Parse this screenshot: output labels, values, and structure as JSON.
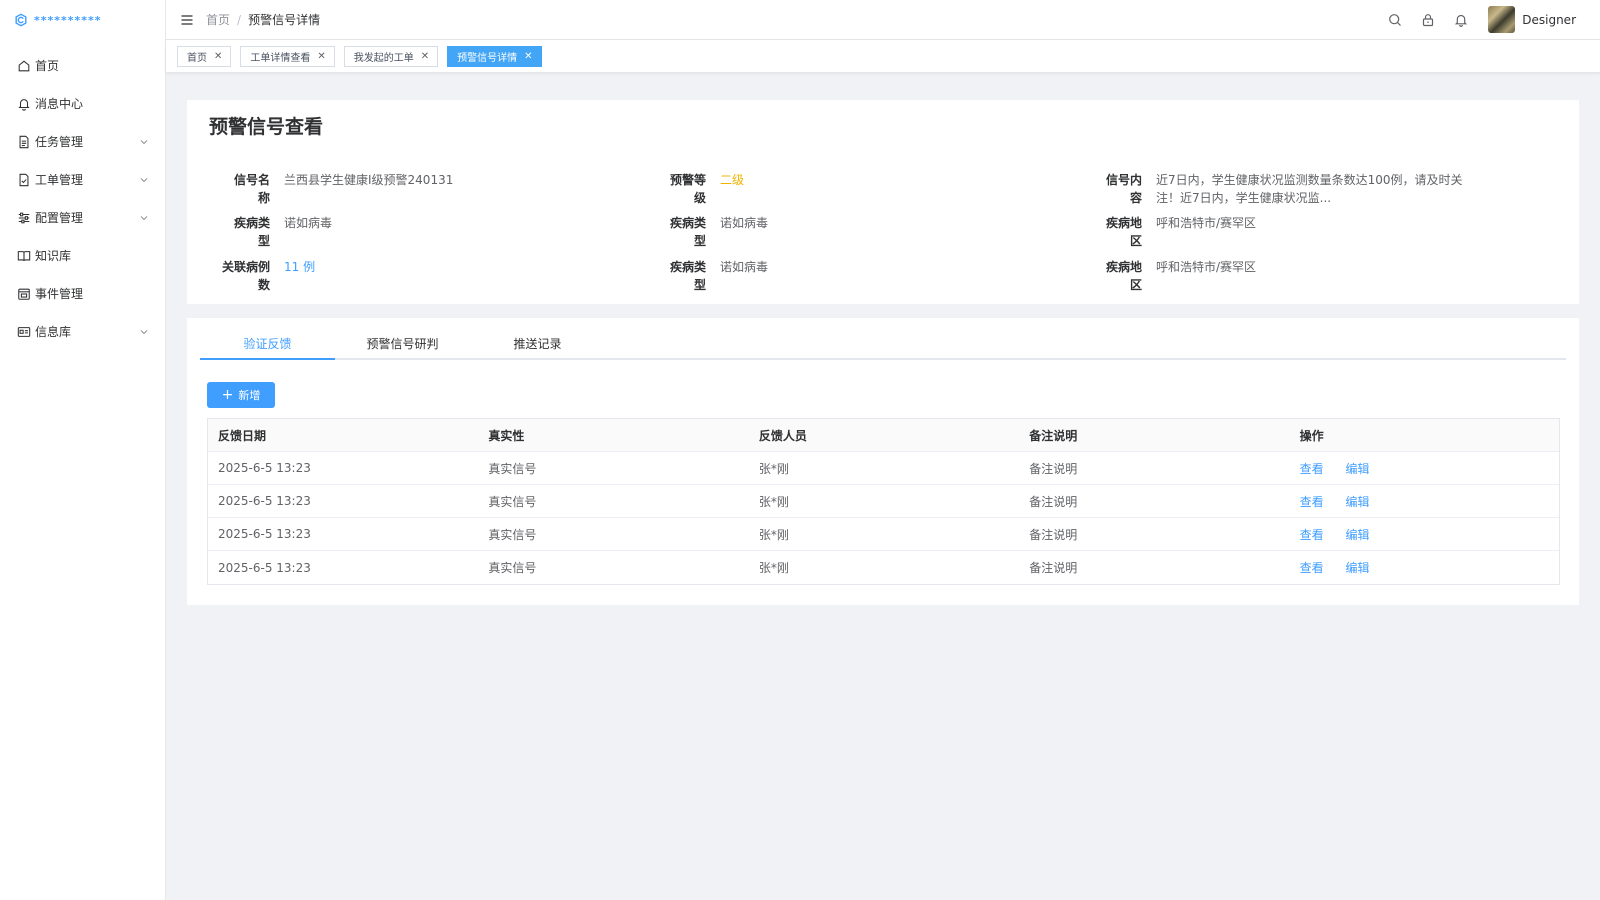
{
  "app": {
    "logo_text": "**********"
  },
  "sidebar": {
    "items": [
      {
        "label": "首页",
        "icon": "home-icon",
        "has_arrow": false
      },
      {
        "label": "消息中心",
        "icon": "bell-icon",
        "has_arrow": false
      },
      {
        "label": "任务管理",
        "icon": "document-icon",
        "has_arrow": true
      },
      {
        "label": "工单管理",
        "icon": "document-check-icon",
        "has_arrow": true
      },
      {
        "label": "配置管理",
        "icon": "sliders-icon",
        "has_arrow": true
      },
      {
        "label": "知识库",
        "icon": "book-icon",
        "has_arrow": false
      },
      {
        "label": "事件管理",
        "icon": "calendar-icon",
        "has_arrow": false
      },
      {
        "label": "信息库",
        "icon": "id-card-icon",
        "has_arrow": true
      }
    ]
  },
  "header": {
    "breadcrumb_home": "首页",
    "breadcrumb_sep": "/",
    "breadcrumb_current": "预警信号详情",
    "username": "Designer"
  },
  "tags": [
    {
      "label": "首页",
      "active": false
    },
    {
      "label": "工单详情查看",
      "active": false
    },
    {
      "label": "我发起的工单",
      "active": false
    },
    {
      "label": "预警信号详情",
      "active": true
    }
  ],
  "detail": {
    "title": "预警信号查看",
    "fields": {
      "signal_name_label": "信号名称",
      "signal_name_value": "兰西县学生健康I级预警240131",
      "warn_level_label": "预警等级",
      "warn_level_value": "二级",
      "signal_content_label": "信号内容",
      "signal_content_value": "近7日内，学生健康状况监测数量条数达100例，请及时关注！近7日内，学生健康状况监...",
      "disease_type_label_1": "疾病类型",
      "disease_type_value_1": "诺如病毒",
      "disease_type_label_2": "疾病类型",
      "disease_type_value_2": "诺如病毒",
      "disease_area_label_1": "疾病地区",
      "disease_area_value_1": "呼和浩特市/赛罕区",
      "related_cases_label": "关联病例数",
      "related_cases_value": "11 例",
      "disease_type_label_3": "疾病类型",
      "disease_type_value_3": "诺如病毒",
      "disease_area_label_2": "疾病地区",
      "disease_area_value_2": "呼和浩特市/赛罕区"
    }
  },
  "tabs": [
    {
      "label": "验证反馈",
      "active": true
    },
    {
      "label": "预警信号研判",
      "active": false
    },
    {
      "label": "推送记录",
      "active": false
    }
  ],
  "add_button_label": "新增",
  "table": {
    "headers": [
      "反馈日期",
      "真实性",
      "反馈人员",
      "备注说明",
      "操作"
    ],
    "rows": [
      {
        "date": "2025-6-5 13:23",
        "authenticity": "真实信号",
        "person": "张*刚",
        "remark": "备注说明",
        "view": "查看",
        "edit": "编辑"
      },
      {
        "date": "2025-6-5 13:23",
        "authenticity": "真实信号",
        "person": "张*刚",
        "remark": "备注说明",
        "view": "查看",
        "edit": "编辑"
      },
      {
        "date": "2025-6-5 13:23",
        "authenticity": "真实信号",
        "person": "张*刚",
        "remark": "备注说明",
        "view": "查看",
        "edit": "编辑"
      },
      {
        "date": "2025-6-5 13:23",
        "authenticity": "真实信号",
        "person": "张*刚",
        "remark": "备注说明",
        "view": "查看",
        "edit": "编辑"
      }
    ]
  },
  "colors": {
    "primary": "#409eff",
    "warning": "#f0b400",
    "active_tag": "#42a5f5"
  }
}
